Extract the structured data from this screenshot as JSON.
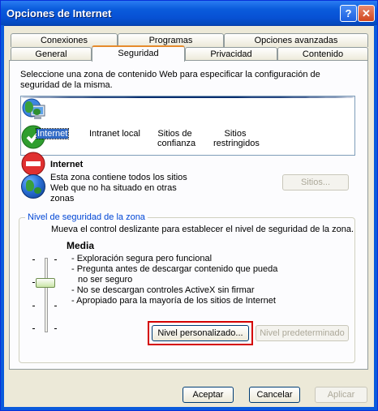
{
  "window": {
    "title": "Opciones de Internet"
  },
  "tabs_row1": [
    "Conexiones",
    "Programas",
    "Opciones avanzadas"
  ],
  "tabs_row2": [
    "General",
    "Seguridad",
    "Privacidad",
    "Contenido"
  ],
  "active_tab": "Seguridad",
  "intro_text": "Seleccione una zona de contenido Web para especificar la configuración de seguridad de la misma.",
  "zones": [
    {
      "label_lines": [
        "Internet"
      ],
      "icon": "globe-icon",
      "selected": true
    },
    {
      "label_lines": [
        "Intranet local"
      ],
      "icon": "intranet-computer-icon",
      "selected": false
    },
    {
      "label_lines": [
        "Sitios de",
        "confianza"
      ],
      "icon": "green-check-icon",
      "selected": false
    },
    {
      "label_lines": [
        "Sitios",
        "restringidos"
      ],
      "icon": "red-no-entry-icon",
      "selected": false
    }
  ],
  "zone_info": {
    "title": "Internet",
    "description_lines": [
      "Esta zona contiene todos los sitios",
      "Web que no ha situado en otras",
      "zonas"
    ],
    "sites_button": "Sitios..."
  },
  "security_level": {
    "group_label": "Nivel de seguridad de la zona",
    "instruction": "Mueva el control deslizante para establecer el nivel de seguridad de la zona.",
    "level_name": "Media",
    "bullets": [
      "- Exploración segura pero funcional",
      "- Pregunta antes de descargar contenido que pueda",
      "  no ser seguro",
      "- No se descargan controles ActiveX sin firmar",
      "- Apropiado para la mayoría de los sitios de Internet"
    ],
    "custom_button": "Nivel personalizado...",
    "default_button": "Nivel predeterminado"
  },
  "footer": {
    "ok": "Aceptar",
    "cancel": "Cancelar",
    "apply": "Aplicar"
  },
  "colors": {
    "title_bar": "#0a5bdc",
    "dialog_bg": "#ece9d8",
    "highlight_box": "#d40000",
    "selection": "#316ac5"
  }
}
